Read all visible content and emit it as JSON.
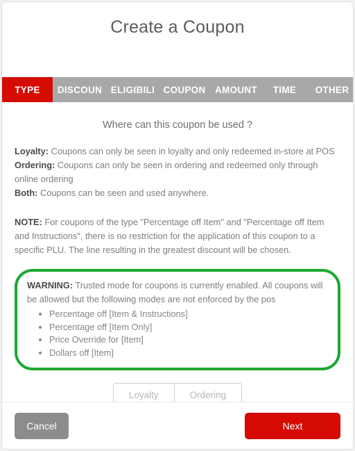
{
  "colors": {
    "accent_red": "#d50b02",
    "tab_gray": "#a8a8a8",
    "warning_green": "#1ca832",
    "cancel_gray": "#8c8c8c",
    "body_text": "#7e7e7e"
  },
  "header": {
    "title": "Create a Coupon"
  },
  "tabs": [
    {
      "label": "TYPE",
      "active": true
    },
    {
      "label": "DISCOUN",
      "active": false
    },
    {
      "label": "ELIGIBILI",
      "active": false
    },
    {
      "label": "COUPON",
      "active": false
    },
    {
      "label": "AMOUNT",
      "active": false
    },
    {
      "label": "TIME",
      "active": false
    },
    {
      "label": "OTHER",
      "active": false
    }
  ],
  "main": {
    "question": "Where can this coupon be used ?",
    "definitions": [
      {
        "term": "Loyalty:",
        "text": " Coupons can only be seen in loyalty and only redeemed in-store at POS"
      },
      {
        "term": "Ordering:",
        "text": " Coupons can only be seen in ordering and redeemed only through online ordering"
      },
      {
        "term": "Both:",
        "text": " Coupons can be seen and used anywhere."
      }
    ],
    "note": {
      "term": "NOTE:",
      "text": " For coupons of the type \"Percentage off Item\" and \"Percentage off Item and Instructions\", there is no restriction for the application of this coupon to a specific PLU. The line resulting in the greatest discount will be chosen."
    },
    "warning": {
      "term": "WARNING:",
      "text": " Trusted mode for coupons is currently enabled. All coupons will be allowed but the following modes are not enforced by the pos",
      "items": [
        "Percentage off [Item & Instructions]",
        "Percentage off [Item Only]",
        "Price Override for [Item]",
        "Dollars off [Item]"
      ]
    },
    "segmented": {
      "options": [
        {
          "label": "Loyalty",
          "selected": false
        },
        {
          "label": "Ordering",
          "selected": false
        }
      ]
    }
  },
  "footer": {
    "cancel_label": "Cancel",
    "next_label": "Next"
  }
}
